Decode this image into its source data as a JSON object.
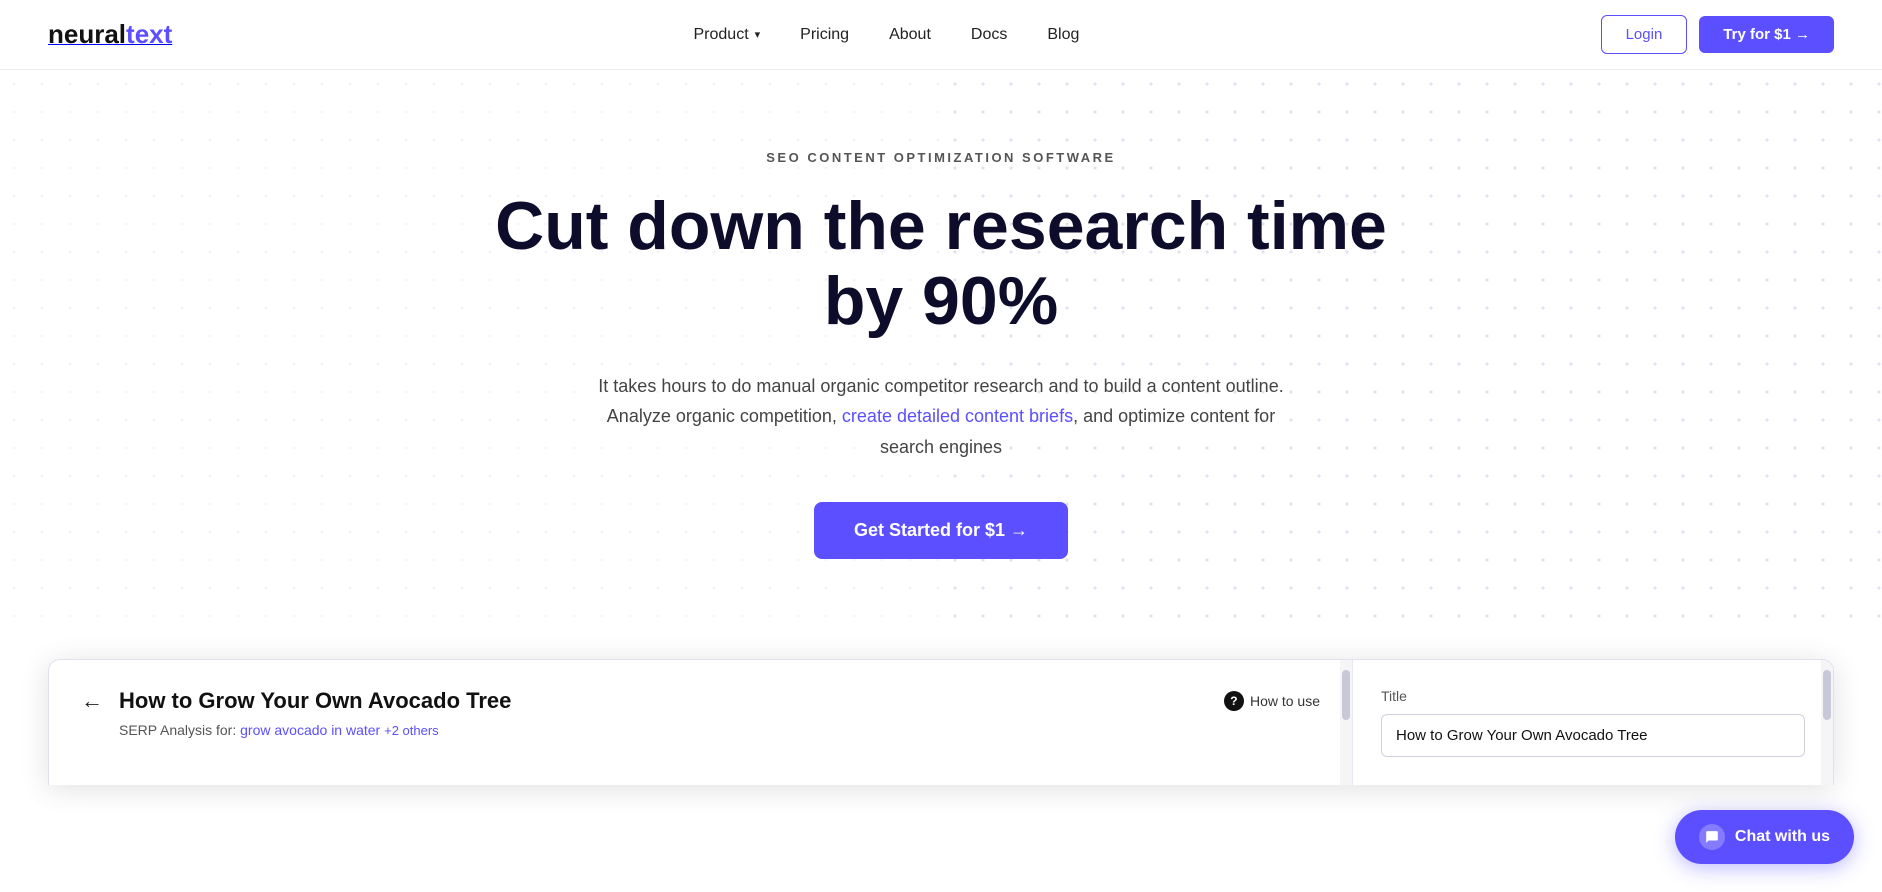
{
  "logo": {
    "text_plain": "neural",
    "text_accent": "text"
  },
  "nav": {
    "links": [
      {
        "label": "Product",
        "has_dropdown": true
      },
      {
        "label": "Pricing",
        "has_dropdown": false
      },
      {
        "label": "About",
        "has_dropdown": false
      },
      {
        "label": "Docs",
        "has_dropdown": false
      },
      {
        "label": "Blog",
        "has_dropdown": false
      }
    ],
    "login_label": "Login",
    "try_label": "Try for $1 →"
  },
  "hero": {
    "subtitle": "SEO CONTENT OPTIMIZATION SOFTWARE",
    "title": "Cut down the research time by 90%",
    "desc_line1": "It takes hours to do manual organic competitor research and to build a content outline.",
    "desc_line2_before": "Analyze organic competition, ",
    "desc_link": "create detailed content briefs",
    "desc_line2_after": ", and optimize content for search engines",
    "cta_label": "Get Started for $1 →"
  },
  "demo": {
    "back_arrow": "←",
    "title": "How to Grow Your Own Avocado Tree",
    "serp_label": "SERP Analysis for:",
    "serp_link": "grow avocado in water",
    "serp_more": "+2 others",
    "how_to_use": "How to use",
    "right_label": "Title",
    "right_input_value": "How to Grow Your Own Avocado Tree"
  },
  "chat_widget": {
    "label": "Chat with us"
  }
}
